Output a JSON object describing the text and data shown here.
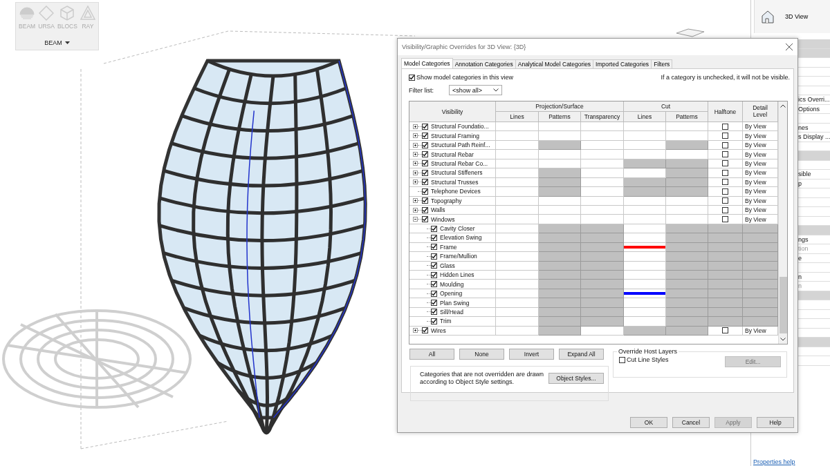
{
  "toolbar": {
    "tools": [
      {
        "label": "BEAM"
      },
      {
        "label": "URSA"
      },
      {
        "label": "BLOCS"
      },
      {
        "label": "RAY"
      }
    ],
    "panel_label": "BEAM"
  },
  "properties_panel": {
    "view_button": "3D View",
    "rows": [
      {
        "kind": "band"
      },
      {
        "kind": "band"
      },
      {
        "kind": "row"
      },
      {
        "kind": "row"
      },
      {
        "kind": "row"
      },
      {
        "kind": "row"
      },
      {
        "kind": "row",
        "text": "ics Overri...",
        "disabled": false
      },
      {
        "kind": "row",
        "text": "Options",
        "disabled": false
      },
      {
        "kind": "row"
      },
      {
        "kind": "row",
        "text": "nes",
        "disabled": false
      },
      {
        "kind": "row",
        "text": "s Display ...",
        "disabled": false
      },
      {
        "kind": "row"
      },
      {
        "kind": "band"
      },
      {
        "kind": "row"
      },
      {
        "kind": "row",
        "text": "sible",
        "disabled": false
      },
      {
        "kind": "row",
        "text": "p",
        "disabled": false
      },
      {
        "kind": "row"
      },
      {
        "kind": "row"
      },
      {
        "kind": "row"
      },
      {
        "kind": "row"
      },
      {
        "kind": "band"
      },
      {
        "kind": "row",
        "text": "ngs",
        "disabled": false
      },
      {
        "kind": "row",
        "text": "tion",
        "disabled": true
      },
      {
        "kind": "row",
        "text": "e",
        "disabled": false
      },
      {
        "kind": "row"
      },
      {
        "kind": "row",
        "text": "n",
        "disabled": false
      },
      {
        "kind": "row",
        "text": "n",
        "disabled": true
      },
      {
        "kind": "band"
      },
      {
        "kind": "row"
      },
      {
        "kind": "row"
      },
      {
        "kind": "row"
      },
      {
        "kind": "row"
      },
      {
        "kind": "band"
      },
      {
        "kind": "row"
      },
      {
        "kind": "row"
      }
    ],
    "help_link": "Properties help"
  },
  "dialog": {
    "title": "Visibility/Graphic Overrides for 3D View: {3D}",
    "tabs": [
      {
        "label": "Model Categories",
        "selected": true
      },
      {
        "label": "Annotation Categories",
        "selected": false
      },
      {
        "label": "Analytical Model Categories",
        "selected": false
      },
      {
        "label": "Imported Categories",
        "selected": false
      },
      {
        "label": "Filters",
        "selected": false
      }
    ],
    "show_checkbox": {
      "label": "Show model categories in this view",
      "checked": true
    },
    "note": "If a category is unchecked, it will not be visible.",
    "filter": {
      "label": "Filter list:",
      "value": "<show all>"
    },
    "table": {
      "columns": {
        "visibility": "Visibility",
        "projection": "Projection/Surface",
        "cut": "Cut",
        "halftone": "Halftone",
        "detail": "Detail Level",
        "projection_sub": [
          "Lines",
          "Patterns",
          "Transparency"
        ],
        "cut_sub": [
          "Lines",
          "Patterns"
        ]
      },
      "rows": [
        {
          "name": "Structural Foundatio...",
          "checked": true,
          "expanded": false,
          "halftone": false,
          "detail_level": "By View",
          "cells": [
            {
              "greyed": false
            },
            {
              "greyed": false
            },
            {
              "greyed": false
            },
            {
              "greyed": false
            },
            {
              "greyed": false
            },
            {
              "greyed": false
            },
            {
              "greyed": false
            }
          ]
        },
        {
          "name": "Structural Framing",
          "checked": true,
          "expanded": false,
          "halftone": false,
          "detail_level": "By View",
          "cells": [
            {
              "greyed": false
            },
            {
              "greyed": false
            },
            {
              "greyed": false
            },
            {
              "greyed": false
            },
            {
              "greyed": false
            },
            {
              "greyed": false
            },
            {
              "greyed": false
            }
          ]
        },
        {
          "name": "Structural Path Reinf...",
          "checked": true,
          "expanded": false,
          "halftone": false,
          "detail_level": "By View",
          "cells": [
            {
              "greyed": false
            },
            {
              "greyed": true
            },
            {
              "greyed": false
            },
            {
              "greyed": false
            },
            {
              "greyed": true
            },
            {
              "greyed": false
            },
            {
              "greyed": false
            }
          ]
        },
        {
          "name": "Structural Rebar",
          "checked": true,
          "expanded": false,
          "halftone": false,
          "detail_level": "By View",
          "cells": [
            {
              "greyed": false
            },
            {
              "greyed": false
            },
            {
              "greyed": false
            },
            {
              "greyed": false
            },
            {
              "greyed": false
            },
            {
              "greyed": false
            },
            {
              "greyed": false
            }
          ]
        },
        {
          "name": "Structural Rebar Co...",
          "checked": true,
          "expanded": false,
          "halftone": false,
          "detail_level": "By View",
          "cells": [
            {
              "greyed": false
            },
            {
              "greyed": false
            },
            {
              "greyed": false
            },
            {
              "greyed": true
            },
            {
              "greyed": true
            },
            {
              "greyed": false
            },
            {
              "greyed": false
            }
          ]
        },
        {
          "name": "Structural Stiffeners",
          "checked": true,
          "expanded": false,
          "halftone": false,
          "detail_level": "By View",
          "cells": [
            {
              "greyed": false
            },
            {
              "greyed": true
            },
            {
              "greyed": false
            },
            {
              "greyed": false
            },
            {
              "greyed": true
            },
            {
              "greyed": false
            },
            {
              "greyed": false
            }
          ]
        },
        {
          "name": "Structural Trusses",
          "checked": true,
          "expanded": false,
          "halftone": false,
          "detail_level": "By View",
          "cells": [
            {
              "greyed": false
            },
            {
              "greyed": true
            },
            {
              "greyed": false
            },
            {
              "greyed": true
            },
            {
              "greyed": true
            },
            {
              "greyed": false
            },
            {
              "greyed": false
            }
          ]
        },
        {
          "name": "Telephone Devices",
          "checked": true,
          "halftone": false,
          "detail_level": "By View",
          "cells": [
            {
              "greyed": false
            },
            {
              "greyed": true
            },
            {
              "greyed": false
            },
            {
              "greyed": true
            },
            {
              "greyed": true
            },
            {
              "greyed": false
            },
            {
              "greyed": false
            }
          ]
        },
        {
          "name": "Topography",
          "checked": true,
          "expanded": false,
          "halftone": false,
          "detail_level": "By View",
          "cells": [
            {
              "greyed": false
            },
            {
              "greyed": false
            },
            {
              "greyed": false
            },
            {
              "greyed": false
            },
            {
              "greyed": false
            },
            {
              "greyed": false
            },
            {
              "greyed": false
            }
          ]
        },
        {
          "name": "Walls",
          "checked": true,
          "expanded": false,
          "halftone": false,
          "detail_level": "By View",
          "cells": [
            {
              "greyed": false
            },
            {
              "greyed": false
            },
            {
              "greyed": false
            },
            {
              "greyed": false
            },
            {
              "greyed": false
            },
            {
              "greyed": false
            },
            {
              "greyed": false
            }
          ]
        },
        {
          "name": "Windows",
          "checked": true,
          "expanded": true,
          "halftone": false,
          "detail_level": "By View",
          "cells": [
            {
              "greyed": false
            },
            {
              "greyed": false
            },
            {
              "greyed": false
            },
            {
              "greyed": false
            },
            {
              "greyed": false
            },
            {
              "greyed": false
            },
            {
              "greyed": false
            }
          ],
          "children": [
            {
              "name": "Cavity Closer",
              "checked": true,
              "cells": [
                {
                  "greyed": false
                },
                {
                  "greyed": true
                },
                {
                  "greyed": true
                },
                {
                  "greyed": false
                },
                {
                  "greyed": true
                },
                {
                  "greyed": true
                },
                {
                  "greyed": true
                }
              ]
            },
            {
              "name": "Elevation Swing",
              "checked": true,
              "cells": [
                {
                  "greyed": false
                },
                {
                  "greyed": true
                },
                {
                  "greyed": true
                },
                {
                  "greyed": false
                },
                {
                  "greyed": true
                },
                {
                  "greyed": true
                },
                {
                  "greyed": true
                }
              ]
            },
            {
              "name": "Frame",
              "checked": true,
              "cells": [
                {
                  "greyed": false
                },
                {
                  "greyed": true
                },
                {
                  "greyed": true
                },
                {
                  "greyed": false,
                  "color": "#ff0000"
                },
                {
                  "greyed": true
                },
                {
                  "greyed": true
                },
                {
                  "greyed": true
                }
              ]
            },
            {
              "name": "Frame/Mullion",
              "checked": true,
              "cells": [
                {
                  "greyed": false
                },
                {
                  "greyed": true
                },
                {
                  "greyed": true
                },
                {
                  "greyed": false
                },
                {
                  "greyed": true
                },
                {
                  "greyed": true
                },
                {
                  "greyed": true
                }
              ]
            },
            {
              "name": "Glass",
              "checked": true,
              "cells": [
                {
                  "greyed": false
                },
                {
                  "greyed": true
                },
                {
                  "greyed": true
                },
                {
                  "greyed": false
                },
                {
                  "greyed": true
                },
                {
                  "greyed": true
                },
                {
                  "greyed": true
                }
              ]
            },
            {
              "name": "Hidden Lines",
              "checked": true,
              "cells": [
                {
                  "greyed": false
                },
                {
                  "greyed": true
                },
                {
                  "greyed": true
                },
                {
                  "greyed": false
                },
                {
                  "greyed": true
                },
                {
                  "greyed": true
                },
                {
                  "greyed": true
                }
              ]
            },
            {
              "name": "Moulding",
              "checked": true,
              "cells": [
                {
                  "greyed": false
                },
                {
                  "greyed": true
                },
                {
                  "greyed": true
                },
                {
                  "greyed": false
                },
                {
                  "greyed": true
                },
                {
                  "greyed": true
                },
                {
                  "greyed": true
                }
              ]
            },
            {
              "name": "Opening",
              "checked": true,
              "cells": [
                {
                  "greyed": false
                },
                {
                  "greyed": true
                },
                {
                  "greyed": true
                },
                {
                  "greyed": false,
                  "color": "#0000ff"
                },
                {
                  "greyed": true
                },
                {
                  "greyed": true
                },
                {
                  "greyed": true
                }
              ]
            },
            {
              "name": "Plan Swing",
              "checked": true,
              "cells": [
                {
                  "greyed": false
                },
                {
                  "greyed": true
                },
                {
                  "greyed": true
                },
                {
                  "greyed": false
                },
                {
                  "greyed": true
                },
                {
                  "greyed": true
                },
                {
                  "greyed": true
                }
              ]
            },
            {
              "name": "Sill/Head",
              "checked": true,
              "cells": [
                {
                  "greyed": false
                },
                {
                  "greyed": true
                },
                {
                  "greyed": true
                },
                {
                  "greyed": false
                },
                {
                  "greyed": true
                },
                {
                  "greyed": true
                },
                {
                  "greyed": true
                }
              ]
            },
            {
              "name": "Trim",
              "checked": true,
              "cells": [
                {
                  "greyed": false
                },
                {
                  "greyed": true
                },
                {
                  "greyed": true
                },
                {
                  "greyed": false
                },
                {
                  "greyed": true
                },
                {
                  "greyed": true
                },
                {
                  "greyed": true
                }
              ]
            }
          ]
        },
        {
          "name": "Wires",
          "checked": true,
          "expanded": false,
          "halftone": false,
          "detail_level": "By View",
          "cells": [
            {
              "greyed": false
            },
            {
              "greyed": true
            },
            {
              "greyed": false
            },
            {
              "greyed": true
            },
            {
              "greyed": true
            },
            {
              "greyed": false
            },
            {
              "greyed": false
            }
          ]
        }
      ]
    },
    "tree_buttons": [
      "All",
      "None",
      "Invert",
      "Expand All"
    ],
    "info": {
      "text": "Categories that are not overridden are drawn according to Object Style settings.",
      "button": "Object Styles..."
    },
    "host_layers": {
      "title": "Override Host Layers",
      "checkbox": {
        "label": "Cut Line Styles",
        "checked": false
      },
      "edit_button": {
        "label": "Edit...",
        "disabled": true
      }
    },
    "footer_buttons": [
      {
        "label": "OK",
        "disabled": false
      },
      {
        "label": "Cancel",
        "disabled": false
      },
      {
        "label": "Apply",
        "disabled": true
      },
      {
        "label": "Help",
        "disabled": false
      }
    ]
  }
}
